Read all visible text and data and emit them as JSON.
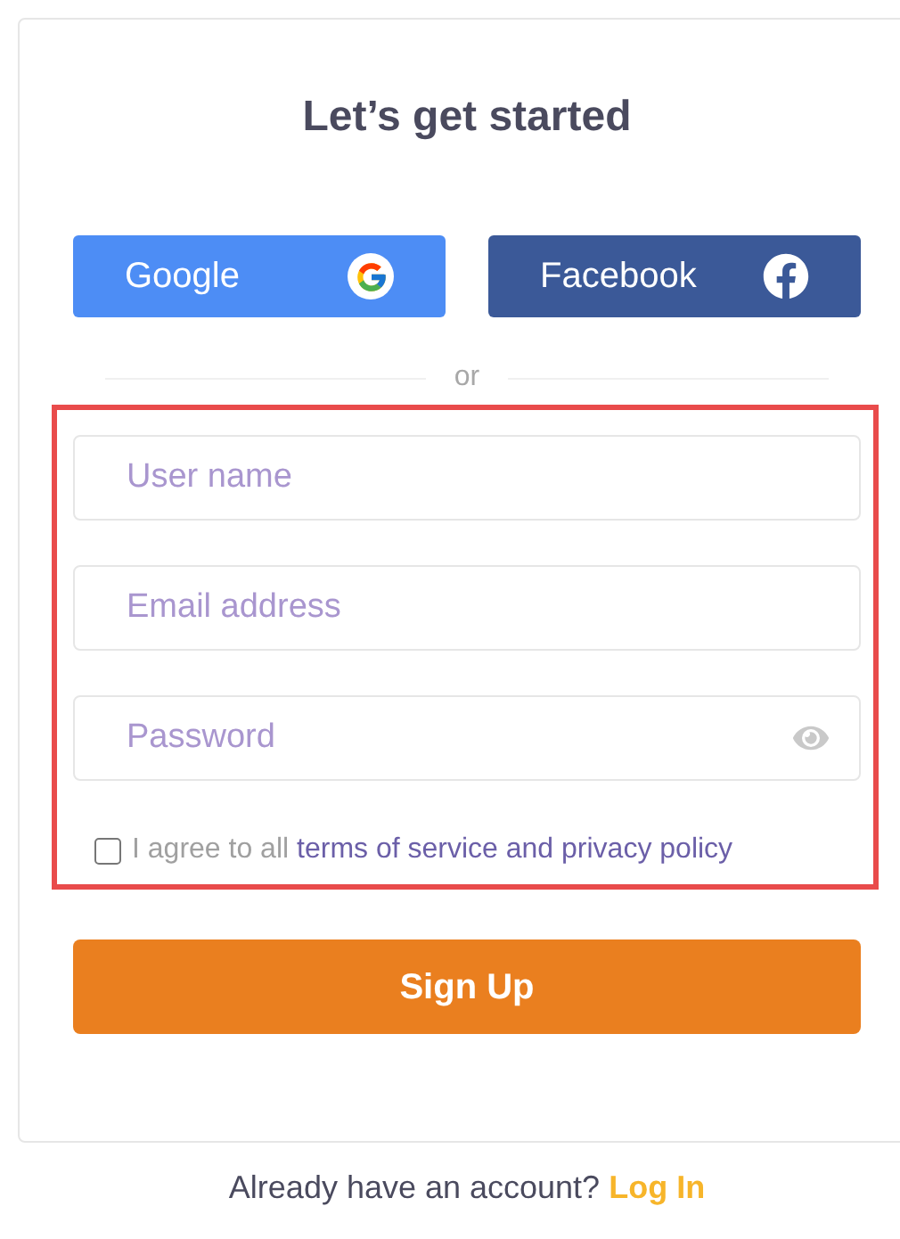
{
  "title": "Let’s get started",
  "social_buttons": [
    {
      "kind": "google",
      "label": "Google",
      "color": "#4d8df5"
    },
    {
      "kind": "facebook",
      "label": "Facebook",
      "color": "#3b5998"
    }
  ],
  "divider": "or",
  "fields": [
    {
      "kind": "text",
      "placeholder": "User name"
    },
    {
      "kind": "email",
      "placeholder": "Email address"
    },
    {
      "kind": "password",
      "placeholder": "Password"
    }
  ],
  "agree": {
    "text": "I agree to all",
    "link": "terms of service and privacy policy",
    "checked": false
  },
  "submit": "Sign Up",
  "footer": {
    "text": "Already have an account?",
    "link": "Log In"
  }
}
